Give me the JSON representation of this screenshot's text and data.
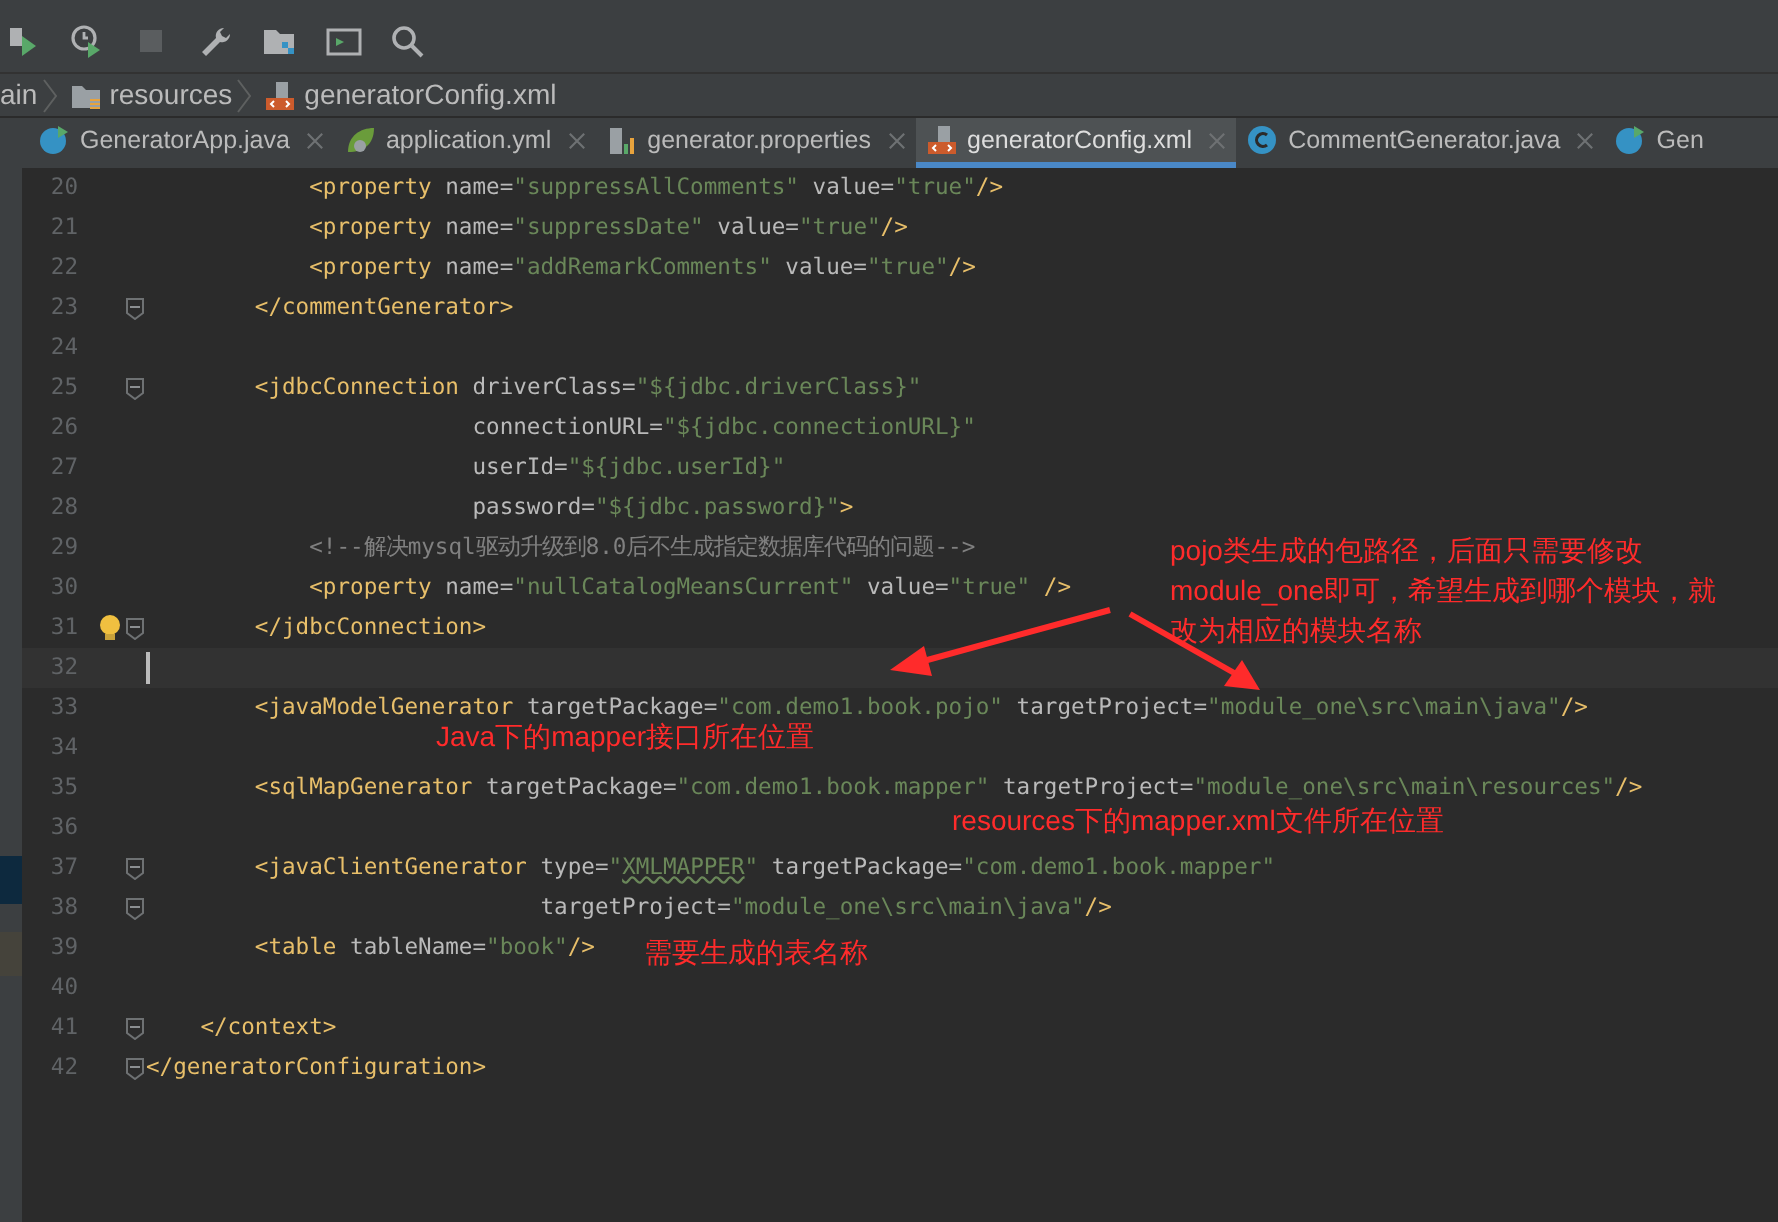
{
  "breadcrumb": [
    {
      "kind": "text",
      "label": "ain"
    },
    {
      "kind": "folder",
      "label": "resources"
    },
    {
      "kind": "xml",
      "label": "generatorConfig.xml"
    }
  ],
  "toolbar": [
    {
      "kind": "run-coverage",
      "disabled": false
    },
    {
      "kind": "profile",
      "disabled": false
    },
    {
      "kind": "stop",
      "disabled": true
    },
    {
      "kind": "wrench",
      "disabled": false
    },
    {
      "kind": "structure",
      "disabled": false
    },
    {
      "kind": "terminal",
      "disabled": false
    },
    {
      "kind": "search",
      "disabled": false
    }
  ],
  "tabs": [
    {
      "label": "GeneratorApp.java",
      "kind": "java-run",
      "selected": false,
      "closable": true
    },
    {
      "label": "application.yml",
      "kind": "yaml",
      "selected": false,
      "closable": true
    },
    {
      "label": "generator.properties",
      "kind": "properties",
      "selected": false,
      "closable": true
    },
    {
      "label": "generatorConfig.xml",
      "kind": "xml",
      "selected": true,
      "closable": true
    },
    {
      "label": "CommentGenerator.java",
      "kind": "java-class",
      "selected": false,
      "closable": true
    },
    {
      "label": "Gen",
      "kind": "java-run",
      "selected": false,
      "closable": false
    }
  ],
  "code_lines": [
    {
      "number": "20",
      "kind": "child",
      "fold": false,
      "current": false,
      "hint": false,
      "tokens": [
        {
          "kind": "tag",
          "text": "<property "
        },
        {
          "kind": "attr",
          "text": "name="
        },
        {
          "kind": "value",
          "text": "\"suppressAllComments\" "
        },
        {
          "kind": "attr",
          "text": "value="
        },
        {
          "kind": "value",
          "text": "\"true\""
        },
        {
          "kind": "tag",
          "text": "/>"
        }
      ]
    },
    {
      "number": "21",
      "kind": "child",
      "fold": false,
      "current": false,
      "hint": false,
      "tokens": [
        {
          "kind": "tag",
          "text": "<property "
        },
        {
          "kind": "attr",
          "text": "name="
        },
        {
          "kind": "value",
          "text": "\"suppressDate\" "
        },
        {
          "kind": "attr",
          "text": "value="
        },
        {
          "kind": "value",
          "text": "\"true\""
        },
        {
          "kind": "tag",
          "text": "/>"
        }
      ]
    },
    {
      "number": "22",
      "kind": "child",
      "fold": false,
      "current": false,
      "hint": false,
      "tokens": [
        {
          "kind": "tag",
          "text": "<property "
        },
        {
          "kind": "attr",
          "text": "name="
        },
        {
          "kind": "value",
          "text": "\"addRemarkComments\" "
        },
        {
          "kind": "attr",
          "text": "value="
        },
        {
          "kind": "value",
          "text": "\"true\""
        },
        {
          "kind": "tag",
          "text": "/>"
        }
      ]
    },
    {
      "number": "23",
      "kind": "element",
      "fold": true,
      "current": false,
      "hint": false,
      "tokens": [
        {
          "kind": "tag",
          "text": "</commentGenerator>"
        }
      ]
    },
    {
      "number": "24",
      "fold": false,
      "current": false,
      "hint": false
    },
    {
      "number": "25",
      "kind": "element",
      "fold": true,
      "current": false,
      "hint": false,
      "tokens": [
        {
          "kind": "tag",
          "text": "<jdbcConnection "
        },
        {
          "kind": "attr",
          "text": "driverClass="
        },
        {
          "kind": "value",
          "text": "\"${jdbc.driverClass}\""
        }
      ]
    },
    {
      "number": "26",
      "kind": "continuation",
      "fold": false,
      "current": false,
      "hint": false,
      "tokens": [
        {
          "kind": "attr",
          "text": "connectionURL="
        },
        {
          "kind": "value",
          "text": "\"${jdbc.connectionURL}\""
        }
      ]
    },
    {
      "number": "27",
      "kind": "continuation",
      "fold": false,
      "current": false,
      "hint": false,
      "tokens": [
        {
          "kind": "attr",
          "text": "userId="
        },
        {
          "kind": "value",
          "text": "\"${jdbc.userId}\""
        }
      ]
    },
    {
      "number": "28",
      "kind": "continuation",
      "fold": false,
      "current": false,
      "hint": false,
      "tokens": [
        {
          "kind": "attr",
          "text": "password="
        },
        {
          "kind": "value",
          "text": "\"${jdbc.password}\""
        },
        {
          "kind": "tag",
          "text": ">"
        }
      ]
    },
    {
      "number": "29",
      "kind": "child",
      "fold": false,
      "current": false,
      "hint": false,
      "tokens": [
        {
          "kind": "comment",
          "text": "<!--解决mysql驱动升级到8.0后不生成指定数据库代码的问题-->"
        }
      ]
    },
    {
      "number": "30",
      "kind": "child",
      "fold": false,
      "current": false,
      "hint": false,
      "tokens": [
        {
          "kind": "tag",
          "text": "<property "
        },
        {
          "kind": "attr",
          "text": "name="
        },
        {
          "kind": "value",
          "text": "\"nullCatalogMeansCurrent\" "
        },
        {
          "kind": "attr",
          "text": "value="
        },
        {
          "kind": "value",
          "text": "\"true\" "
        },
        {
          "kind": "tag",
          "text": "/>"
        }
      ]
    },
    {
      "number": "31",
      "kind": "element",
      "fold": true,
      "current": false,
      "hint": true,
      "tokens": [
        {
          "kind": "tag",
          "text": "</jdbcConnection>"
        }
      ]
    },
    {
      "number": "32",
      "fold": false,
      "current": true,
      "hint": false
    },
    {
      "number": "33",
      "kind": "element",
      "fold": false,
      "current": false,
      "hint": false,
      "tokens": [
        {
          "kind": "tag",
          "text": "<javaModelGenerator "
        },
        {
          "kind": "attr",
          "text": "targetPackage="
        },
        {
          "kind": "value",
          "text": "\"com.demo1.book.pojo\" "
        },
        {
          "kind": "attr",
          "text": "targetProject="
        },
        {
          "kind": "value",
          "text": "\"module_one\\src\\main\\java\""
        },
        {
          "kind": "tag",
          "text": "/>"
        }
      ]
    },
    {
      "number": "34",
      "fold": false,
      "current": false,
      "hint": false
    },
    {
      "number": "35",
      "kind": "element",
      "fold": false,
      "current": false,
      "hint": false,
      "tokens": [
        {
          "kind": "tag",
          "text": "<sqlMapGenerator "
        },
        {
          "kind": "attr",
          "text": "targetPackage="
        },
        {
          "kind": "value",
          "text": "\"com.demo1.book.mapper\" "
        },
        {
          "kind": "attr",
          "text": "targetProject="
        },
        {
          "kind": "value",
          "text": "\"module_one\\src\\main\\resources\""
        },
        {
          "kind": "tag",
          "text": "/>"
        }
      ]
    },
    {
      "number": "36",
      "fold": false,
      "current": false,
      "hint": false
    },
    {
      "number": "37",
      "kind": "element",
      "fold": true,
      "current": false,
      "hint": false,
      "tokens": [
        {
          "kind": "tag",
          "text": "<javaClientGenerator "
        },
        {
          "kind": "attr",
          "text": "type="
        },
        {
          "kind": "value",
          "text": "\""
        },
        {
          "kind": "value",
          "text": "XMLMAPPER",
          "squiggle": true
        },
        {
          "kind": "value",
          "text": "\" "
        },
        {
          "kind": "attr",
          "text": "targetPackage="
        },
        {
          "kind": "value",
          "text": "\"com.demo1.book.mapper\""
        }
      ]
    },
    {
      "number": "38",
      "kind": "wrapped-attribute",
      "fold": true,
      "current": false,
      "hint": false,
      "tokens": [
        {
          "kind": "attr",
          "text": "targetProject="
        },
        {
          "kind": "value",
          "text": "\"module_one\\src\\main\\java\""
        },
        {
          "kind": "tag",
          "text": "/>"
        }
      ]
    },
    {
      "number": "39",
      "kind": "element",
      "fold": false,
      "current": false,
      "hint": false,
      "tokens": [
        {
          "kind": "tag",
          "text": "<table "
        },
        {
          "kind": "attr",
          "text": "tableName="
        },
        {
          "kind": "value",
          "text": "\"book\""
        },
        {
          "kind": "tag",
          "text": "/>"
        }
      ]
    },
    {
      "number": "40",
      "fold": false,
      "current": false,
      "hint": false
    },
    {
      "number": "41",
      "kind": "section",
      "fold": true,
      "current": false,
      "hint": false,
      "tokens": [
        {
          "kind": "tag",
          "text": "</context>"
        }
      ]
    },
    {
      "number": "42",
      "kind": "top",
      "fold": true,
      "current": false,
      "hint": false,
      "tokens": [
        {
          "kind": "tag",
          "text": "</generatorConfiguration>"
        }
      ]
    }
  ],
  "annotations": [
    {
      "kind": "package-note",
      "text": "pojo类生成的包路径，后面只需要修改module_one即可，希望生成到哪个模块，就改为相应的模块名称"
    },
    {
      "kind": "java-note",
      "text": "Java下的mapper接口所在位置"
    },
    {
      "kind": "resources-note",
      "text": "resources下的mapper.xml文件所在位置"
    },
    {
      "kind": "table-note",
      "text": "需要生成的表名称"
    }
  ]
}
